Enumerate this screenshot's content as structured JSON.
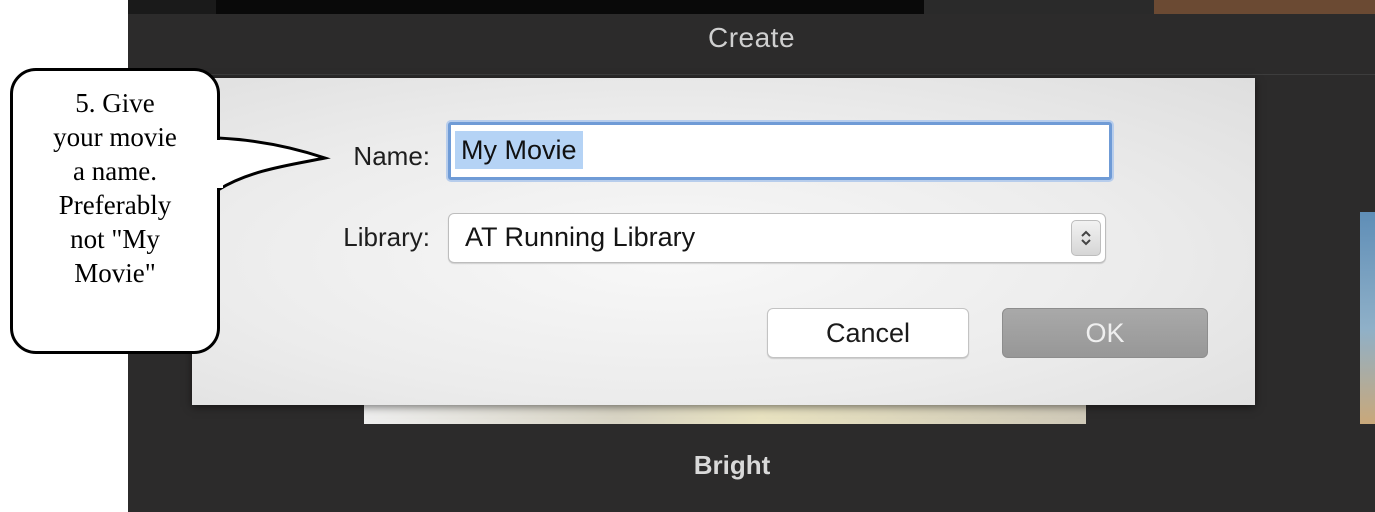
{
  "window": {
    "title": "Create"
  },
  "dialog": {
    "name_label": "Name:",
    "name_value": "My Movie",
    "library_label": "Library:",
    "library_value": "AT Running Library",
    "cancel_label": "Cancel",
    "ok_label": "OK"
  },
  "background": {
    "theme_label": "Bright"
  },
  "callout": {
    "lines": [
      "5. Give",
      "your movie",
      "a name.",
      "Preferably",
      "not \"My",
      "Movie\""
    ]
  },
  "icons": {
    "library_stepper": "up-down-chevron-icon"
  },
  "colors": {
    "selection": "#b5d3f5",
    "focus_ring": "#6f9bd6",
    "app_background": "#2c2b2b",
    "ok_button": "#a0a0a0"
  }
}
